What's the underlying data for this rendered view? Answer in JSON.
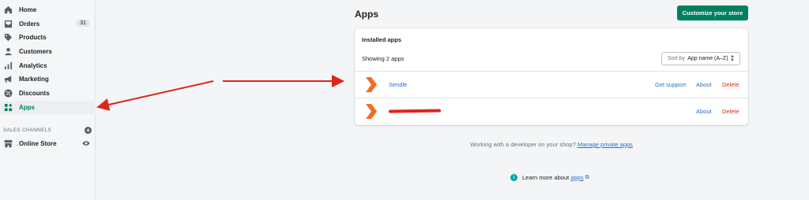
{
  "sidebar": {
    "items": [
      {
        "label": "Home",
        "icon": "home-icon"
      },
      {
        "label": "Orders",
        "icon": "orders-icon",
        "badge": "31"
      },
      {
        "label": "Products",
        "icon": "tag-icon"
      },
      {
        "label": "Customers",
        "icon": "person-icon"
      },
      {
        "label": "Analytics",
        "icon": "bar-chart-icon"
      },
      {
        "label": "Marketing",
        "icon": "megaphone-icon"
      },
      {
        "label": "Discounts",
        "icon": "discount-icon"
      },
      {
        "label": "Apps",
        "icon": "apps-icon",
        "active": true
      }
    ],
    "sales_channels_header": "SALES CHANNELS",
    "online_store": "Online Store"
  },
  "main": {
    "title": "Apps",
    "primary_button": "Customize your store",
    "card": {
      "title": "Installed apps",
      "showing": "Showing 2 apps",
      "sort_prefix": "Sort by",
      "sort_value": "App name (A–Z)",
      "apps": [
        {
          "name": "Sendle",
          "get_support": "Get support",
          "about": "About",
          "delete": "Delete"
        },
        {
          "name": "",
          "about": "About",
          "delete": "Delete"
        }
      ]
    },
    "footer": {
      "text": "Working with a developer on your shop?",
      "link": "Manage private apps"
    },
    "learn_more": {
      "text": "Learn more about",
      "link": "apps"
    }
  },
  "colors": {
    "accent": "#008060",
    "link": "#2c6ecb",
    "danger": "#d72c0d",
    "annotation_arrow": "#e0251b",
    "app_icon": "#f26c21"
  }
}
